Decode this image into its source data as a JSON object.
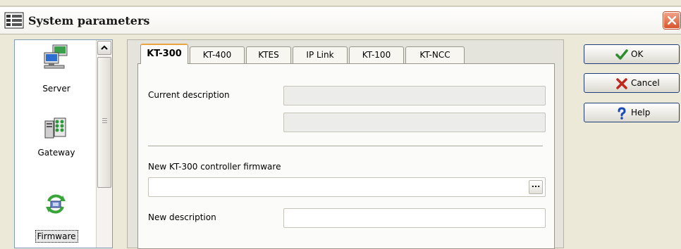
{
  "window": {
    "title": "System parameters",
    "close_icon": "close-icon"
  },
  "nav": {
    "items": [
      {
        "label": "Server",
        "icon": "server-icon",
        "selected": false
      },
      {
        "label": "Gateway",
        "icon": "gateway-icon",
        "selected": false
      },
      {
        "label": "Firmware",
        "icon": "firmware-icon",
        "selected": true
      }
    ]
  },
  "tabs": [
    {
      "label": "KT-300",
      "active": true
    },
    {
      "label": "KT-400",
      "active": false
    },
    {
      "label": "KTES",
      "active": false
    },
    {
      "label": "IP Link",
      "active": false
    },
    {
      "label": "KT-100",
      "active": false
    },
    {
      "label": "KT-NCC",
      "active": false
    }
  ],
  "panel": {
    "current_description_label": "Current description",
    "current_description_line1": "",
    "current_description_line2": "",
    "new_firmware_label": "New KT-300 controller firmware",
    "new_firmware_value": "",
    "browse_label": "...",
    "new_description_label": "New description",
    "new_description_value": ""
  },
  "buttons": {
    "ok": "OK",
    "cancel": "Cancel",
    "help": "Help"
  },
  "colors": {
    "accent_tab": "#e9a33f",
    "ok_check": "#2e8b2e",
    "cancel_x": "#c0281e",
    "help_q": "#1b49b8",
    "close_bg": "#d8542b"
  }
}
